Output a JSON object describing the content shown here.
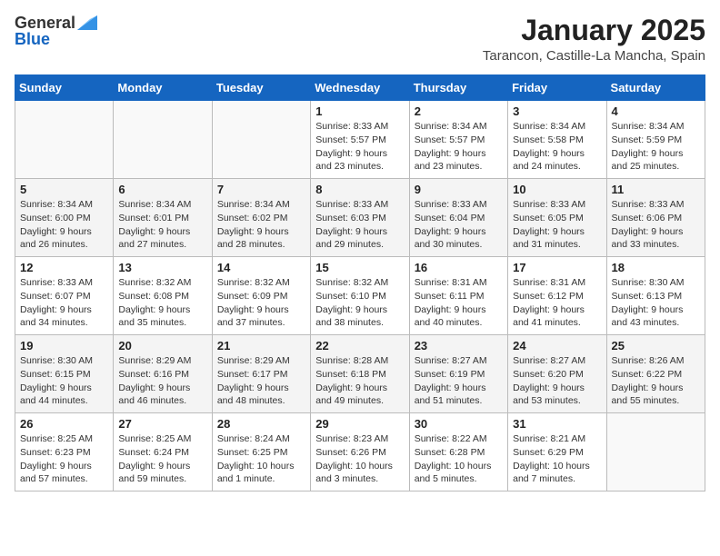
{
  "header": {
    "logo_general": "General",
    "logo_blue": "Blue",
    "month": "January 2025",
    "location": "Tarancon, Castille-La Mancha, Spain"
  },
  "weekdays": [
    "Sunday",
    "Monday",
    "Tuesday",
    "Wednesday",
    "Thursday",
    "Friday",
    "Saturday"
  ],
  "weeks": [
    [
      {
        "day": "",
        "sunrise": "",
        "sunset": "",
        "daylight": ""
      },
      {
        "day": "",
        "sunrise": "",
        "sunset": "",
        "daylight": ""
      },
      {
        "day": "",
        "sunrise": "",
        "sunset": "",
        "daylight": ""
      },
      {
        "day": "1",
        "sunrise": "Sunrise: 8:33 AM",
        "sunset": "Sunset: 5:57 PM",
        "daylight": "Daylight: 9 hours and 23 minutes."
      },
      {
        "day": "2",
        "sunrise": "Sunrise: 8:34 AM",
        "sunset": "Sunset: 5:57 PM",
        "daylight": "Daylight: 9 hours and 23 minutes."
      },
      {
        "day": "3",
        "sunrise": "Sunrise: 8:34 AM",
        "sunset": "Sunset: 5:58 PM",
        "daylight": "Daylight: 9 hours and 24 minutes."
      },
      {
        "day": "4",
        "sunrise": "Sunrise: 8:34 AM",
        "sunset": "Sunset: 5:59 PM",
        "daylight": "Daylight: 9 hours and 25 minutes."
      }
    ],
    [
      {
        "day": "5",
        "sunrise": "Sunrise: 8:34 AM",
        "sunset": "Sunset: 6:00 PM",
        "daylight": "Daylight: 9 hours and 26 minutes."
      },
      {
        "day": "6",
        "sunrise": "Sunrise: 8:34 AM",
        "sunset": "Sunset: 6:01 PM",
        "daylight": "Daylight: 9 hours and 27 minutes."
      },
      {
        "day": "7",
        "sunrise": "Sunrise: 8:34 AM",
        "sunset": "Sunset: 6:02 PM",
        "daylight": "Daylight: 9 hours and 28 minutes."
      },
      {
        "day": "8",
        "sunrise": "Sunrise: 8:33 AM",
        "sunset": "Sunset: 6:03 PM",
        "daylight": "Daylight: 9 hours and 29 minutes."
      },
      {
        "day": "9",
        "sunrise": "Sunrise: 8:33 AM",
        "sunset": "Sunset: 6:04 PM",
        "daylight": "Daylight: 9 hours and 30 minutes."
      },
      {
        "day": "10",
        "sunrise": "Sunrise: 8:33 AM",
        "sunset": "Sunset: 6:05 PM",
        "daylight": "Daylight: 9 hours and 31 minutes."
      },
      {
        "day": "11",
        "sunrise": "Sunrise: 8:33 AM",
        "sunset": "Sunset: 6:06 PM",
        "daylight": "Daylight: 9 hours and 33 minutes."
      }
    ],
    [
      {
        "day": "12",
        "sunrise": "Sunrise: 8:33 AM",
        "sunset": "Sunset: 6:07 PM",
        "daylight": "Daylight: 9 hours and 34 minutes."
      },
      {
        "day": "13",
        "sunrise": "Sunrise: 8:32 AM",
        "sunset": "Sunset: 6:08 PM",
        "daylight": "Daylight: 9 hours and 35 minutes."
      },
      {
        "day": "14",
        "sunrise": "Sunrise: 8:32 AM",
        "sunset": "Sunset: 6:09 PM",
        "daylight": "Daylight: 9 hours and 37 minutes."
      },
      {
        "day": "15",
        "sunrise": "Sunrise: 8:32 AM",
        "sunset": "Sunset: 6:10 PM",
        "daylight": "Daylight: 9 hours and 38 minutes."
      },
      {
        "day": "16",
        "sunrise": "Sunrise: 8:31 AM",
        "sunset": "Sunset: 6:11 PM",
        "daylight": "Daylight: 9 hours and 40 minutes."
      },
      {
        "day": "17",
        "sunrise": "Sunrise: 8:31 AM",
        "sunset": "Sunset: 6:12 PM",
        "daylight": "Daylight: 9 hours and 41 minutes."
      },
      {
        "day": "18",
        "sunrise": "Sunrise: 8:30 AM",
        "sunset": "Sunset: 6:13 PM",
        "daylight": "Daylight: 9 hours and 43 minutes."
      }
    ],
    [
      {
        "day": "19",
        "sunrise": "Sunrise: 8:30 AM",
        "sunset": "Sunset: 6:15 PM",
        "daylight": "Daylight: 9 hours and 44 minutes."
      },
      {
        "day": "20",
        "sunrise": "Sunrise: 8:29 AM",
        "sunset": "Sunset: 6:16 PM",
        "daylight": "Daylight: 9 hours and 46 minutes."
      },
      {
        "day": "21",
        "sunrise": "Sunrise: 8:29 AM",
        "sunset": "Sunset: 6:17 PM",
        "daylight": "Daylight: 9 hours and 48 minutes."
      },
      {
        "day": "22",
        "sunrise": "Sunrise: 8:28 AM",
        "sunset": "Sunset: 6:18 PM",
        "daylight": "Daylight: 9 hours and 49 minutes."
      },
      {
        "day": "23",
        "sunrise": "Sunrise: 8:27 AM",
        "sunset": "Sunset: 6:19 PM",
        "daylight": "Daylight: 9 hours and 51 minutes."
      },
      {
        "day": "24",
        "sunrise": "Sunrise: 8:27 AM",
        "sunset": "Sunset: 6:20 PM",
        "daylight": "Daylight: 9 hours and 53 minutes."
      },
      {
        "day": "25",
        "sunrise": "Sunrise: 8:26 AM",
        "sunset": "Sunset: 6:22 PM",
        "daylight": "Daylight: 9 hours and 55 minutes."
      }
    ],
    [
      {
        "day": "26",
        "sunrise": "Sunrise: 8:25 AM",
        "sunset": "Sunset: 6:23 PM",
        "daylight": "Daylight: 9 hours and 57 minutes."
      },
      {
        "day": "27",
        "sunrise": "Sunrise: 8:25 AM",
        "sunset": "Sunset: 6:24 PM",
        "daylight": "Daylight: 9 hours and 59 minutes."
      },
      {
        "day": "28",
        "sunrise": "Sunrise: 8:24 AM",
        "sunset": "Sunset: 6:25 PM",
        "daylight": "Daylight: 10 hours and 1 minute."
      },
      {
        "day": "29",
        "sunrise": "Sunrise: 8:23 AM",
        "sunset": "Sunset: 6:26 PM",
        "daylight": "Daylight: 10 hours and 3 minutes."
      },
      {
        "day": "30",
        "sunrise": "Sunrise: 8:22 AM",
        "sunset": "Sunset: 6:28 PM",
        "daylight": "Daylight: 10 hours and 5 minutes."
      },
      {
        "day": "31",
        "sunrise": "Sunrise: 8:21 AM",
        "sunset": "Sunset: 6:29 PM",
        "daylight": "Daylight: 10 hours and 7 minutes."
      },
      {
        "day": "",
        "sunrise": "",
        "sunset": "",
        "daylight": ""
      }
    ]
  ]
}
